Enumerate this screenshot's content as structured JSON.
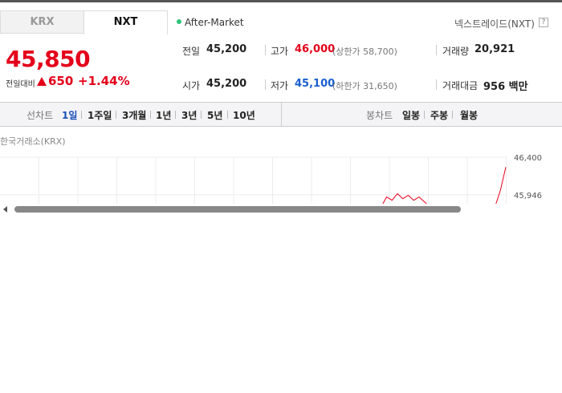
{
  "tabs": {
    "krx": "KRX",
    "nxt": "NXT"
  },
  "session": {
    "label": "After-Market",
    "dot_color": "#2fc47a"
  },
  "provider": {
    "label": "넥스트레이드(NXT)",
    "help": "?"
  },
  "price": {
    "current": "45,850",
    "prev_label": "전일대비",
    "change": "650",
    "change_pct": "+1.44%",
    "color": "#e4001b"
  },
  "stats": {
    "prev_close": {
      "label": "전일",
      "value": "45,200"
    },
    "high": {
      "label": "고가",
      "value": "46,000",
      "sub": "(상한가 58,700)"
    },
    "volume": {
      "label": "거래량",
      "value": "20,921"
    },
    "open": {
      "label": "시가",
      "value": "45,200"
    },
    "low": {
      "label": "저가",
      "value": "45,100",
      "sub": "(하한가 31,650)"
    },
    "amount": {
      "label": "거래대금",
      "value": "956 백만"
    }
  },
  "period_bar": {
    "line_label": "선차트",
    "line_options": [
      "1일",
      "1주일",
      "3개월",
      "1년",
      "3년",
      "5년",
      "10년"
    ],
    "active": "1일",
    "candle_label": "봉차트",
    "candle_options": [
      "일봉",
      "주봉",
      "월봉"
    ]
  },
  "chart": {
    "title": "한국거래소(KRX)",
    "y_ticks": [
      "46,400",
      "45,946"
    ],
    "line_color": "#e4001b"
  },
  "chart_data": {
    "type": "line",
    "title": "한국거래소(KRX)",
    "y_tick_labels": [
      "46,400",
      "45,946"
    ],
    "ylim": [
      45800,
      46400
    ],
    "series": [
      {
        "values": [
          45800,
          45800,
          45800,
          45800,
          45800,
          45800,
          45800,
          45800,
          45810,
          45830,
          45800,
          45800,
          45800,
          45800,
          45800,
          45800,
          45800,
          45800,
          45920,
          45880,
          45960,
          45900,
          45940,
          45880,
          45920,
          45860,
          45800,
          45800,
          45800,
          45800,
          45830,
          45800,
          45800,
          45800,
          45800,
          45830,
          45800,
          45800,
          45800,
          46000,
          46280
        ]
      }
    ],
    "grid": true
  }
}
